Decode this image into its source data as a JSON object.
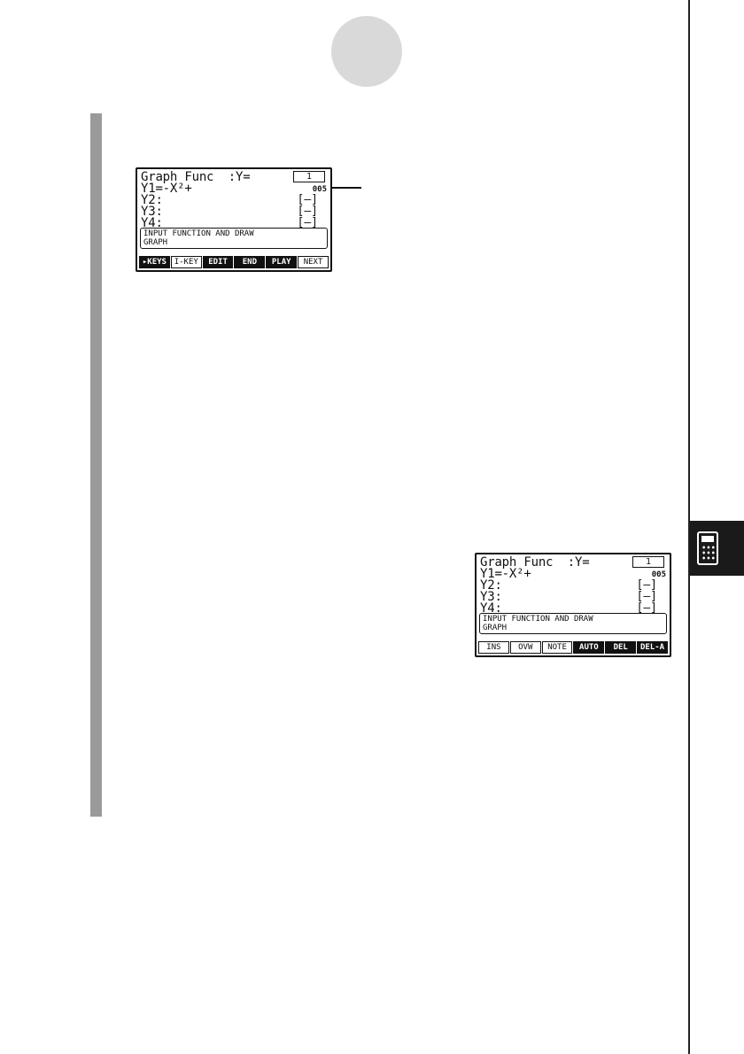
{
  "screen1": {
    "title": "Graph Func  :Y=",
    "indicator": "1",
    "counter": "005",
    "y1": "Y1=-X²+",
    "y2": "Y2:",
    "y3": "Y3:",
    "y4": "Y4:",
    "bracket": "[—]",
    "message_line1": "INPUT FUNCTION AND DRAW",
    "message_line2": "GRAPH",
    "menu": [
      "▸KEYS",
      "I-KEY",
      "EDIT",
      "END",
      "PLAY",
      "NEXT"
    ]
  },
  "screen2": {
    "title": "Graph Func  :Y=",
    "indicator": "1",
    "counter": "005",
    "y1": "Y1=-X²+",
    "y2": "Y2:",
    "y3": "Y3:",
    "y4": "Y4:",
    "bracket": "[—]",
    "message_line1": "INPUT FUNCTION AND DRAW",
    "message_line2": "GRAPH",
    "menu": [
      "INS",
      "OVW",
      "NOTE",
      "AUTO",
      "DEL",
      "DEL-A"
    ]
  },
  "icons": {
    "chapter_tab": "calculator-icon"
  }
}
